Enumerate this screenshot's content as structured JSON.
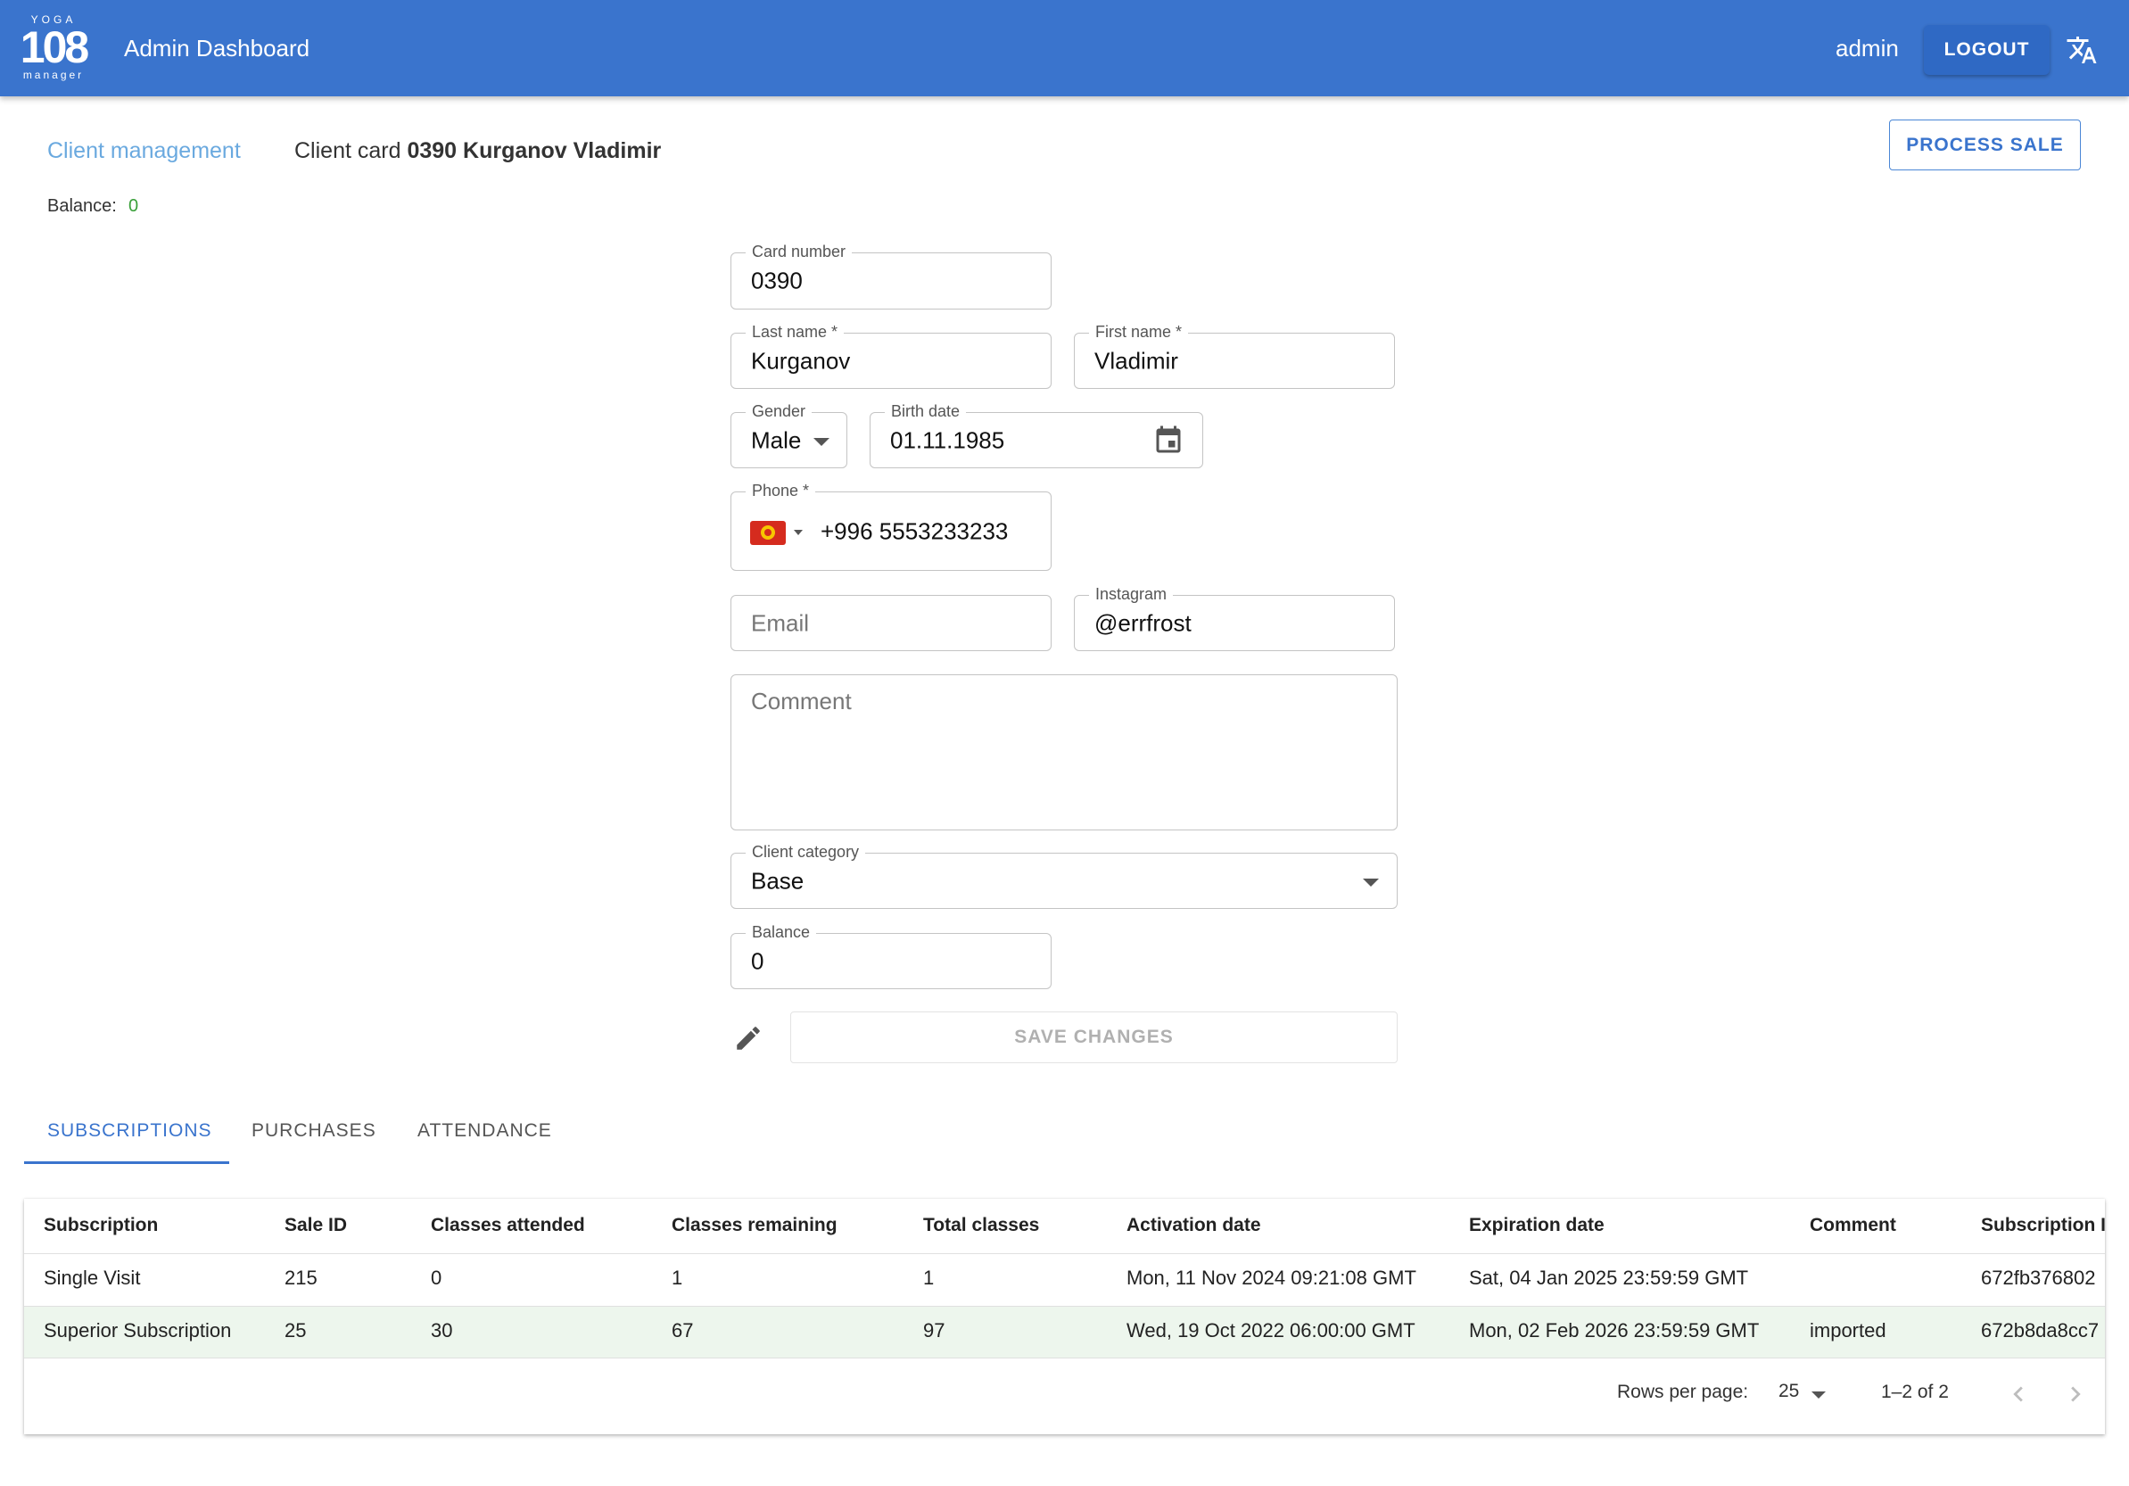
{
  "appbar": {
    "logo": {
      "top": "YOGA",
      "number": "108",
      "bottom": "manager"
    },
    "title": "Admin Dashboard",
    "user": "admin",
    "logout_label": "LOGOUT",
    "translate_icon": "translate-icon"
  },
  "header": {
    "breadcrumb_link": "Client management",
    "card_prefix": "Client card",
    "card_name": "0390 Kurganov Vladimir",
    "process_sale_label": "PROCESS SALE",
    "balance_label": "Balance:",
    "balance_value": "0"
  },
  "form": {
    "card_number": {
      "label": "Card number",
      "value": "0390"
    },
    "last_name": {
      "label": "Last name *",
      "value": "Kurganov"
    },
    "first_name": {
      "label": "First name *",
      "value": "Vladimir"
    },
    "gender": {
      "label": "Gender",
      "value": "Male"
    },
    "birth_date": {
      "label": "Birth date",
      "value": "01.11.1985"
    },
    "phone": {
      "label": "Phone *",
      "value": "+996 5553233233",
      "flag_icon": "kyrgyzstan-flag-icon"
    },
    "email": {
      "placeholder": "Email"
    },
    "instagram": {
      "label": "Instagram",
      "value": "@errfrost"
    },
    "comment": {
      "placeholder": "Comment"
    },
    "client_category": {
      "label": "Client category",
      "value": "Base"
    },
    "balance": {
      "label": "Balance",
      "value": "0"
    },
    "save_label": "SAVE CHANGES"
  },
  "tabs": [
    {
      "label": "SUBSCRIPTIONS",
      "active": true
    },
    {
      "label": "PURCHASES",
      "active": false
    },
    {
      "label": "ATTENDANCE",
      "active": false
    }
  ],
  "table": {
    "columns": [
      "Subscription",
      "Sale ID",
      "Classes attended",
      "Classes remaining",
      "Total classes",
      "Activation date",
      "Expiration date",
      "Comment",
      "Subscription I"
    ],
    "rows": [
      [
        "Single Visit",
        "215",
        "0",
        "1",
        "1",
        "Mon, 11 Nov 2024 09:21:08 GMT",
        "Sat, 04 Jan 2025 23:59:59 GMT",
        "",
        "672fb376802"
      ],
      [
        "Superior Subscription",
        "25",
        "30",
        "67",
        "97",
        "Wed, 19 Oct 2022 06:00:00 GMT",
        "Mon, 02 Feb 2026 23:59:59 GMT",
        "imported",
        "672b8da8cc7"
      ]
    ],
    "pagination": {
      "rows_per_page_label": "Rows per page:",
      "rows_per_page": "25",
      "range": "1–2 of 2"
    }
  },
  "colors": {
    "primary": "#3a74cd",
    "link": "#6aa9df",
    "balance_positive": "#3aa03a",
    "highlight_row": "#edf6ed"
  }
}
